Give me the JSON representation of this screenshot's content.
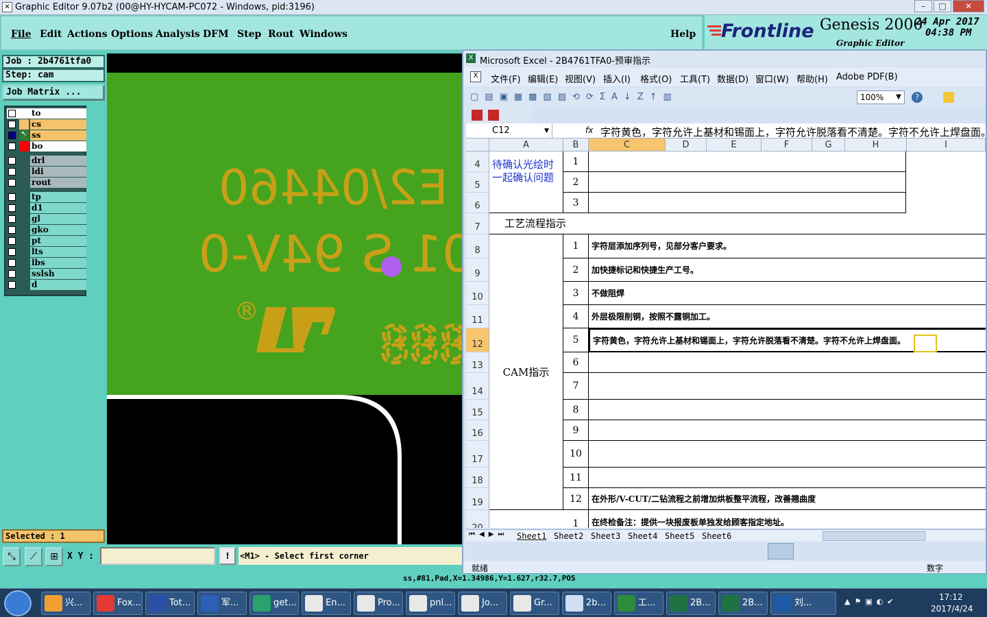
{
  "titlebar": {
    "title": "Graphic Editor 9.07b2 (00@HY-HYCAM-PC072 - Windows, pid:3196)"
  },
  "menu": [
    "File",
    "Edit",
    "Actions",
    "Options",
    "Analysis",
    "DFM",
    "Step",
    "Rout",
    "Windows"
  ],
  "help": "Help",
  "brand": {
    "logo": "Frontline",
    "product": "Genesis 2000",
    "date": "24 Apr 2017",
    "time": "04:38 PM",
    "subtitle": "Graphic Editor"
  },
  "job": {
    "job_label": "Job  : 2b4761tfa0",
    "step_label": "Step: cam",
    "matrix_button": "Job Matrix ..."
  },
  "layers_group1": [
    {
      "name": "to",
      "bg": "#ffffff",
      "color": ""
    },
    {
      "name": "cs",
      "bg": "#f3c26a",
      "color": ""
    },
    {
      "name": "ss",
      "bg": "#f3c26a",
      "color": "#2e7d32"
    },
    {
      "name": "bo",
      "bg": "#ffffff",
      "color": "#ff0000"
    }
  ],
  "layers_group2": [
    {
      "name": "drl"
    },
    {
      "name": "ldi"
    },
    {
      "name": "rout"
    }
  ],
  "layers_group3": [
    {
      "name": "tp"
    },
    {
      "name": "d1"
    },
    {
      "name": "gl"
    },
    {
      "name": "gko"
    },
    {
      "name": "pt"
    },
    {
      "name": "lts"
    },
    {
      "name": "lbs"
    },
    {
      "name": "sslsh"
    },
    {
      "name": "d"
    }
  ],
  "selected": "Selected : 1",
  "canvas_text": {
    "line1": "E2/04460",
    "line2": "01 S 94V-0",
    "digits": "888",
    "mark": "®"
  },
  "bottom": {
    "xy_label": "X Y :",
    "prompt": "<M1> - Select first corner",
    "status": "ss,#81,Pad,X=1.34986,Y=1.627,r32.7,POS"
  },
  "excel": {
    "title": "Microsoft Excel - 2B4761TFA0-预审指示",
    "menu": [
      "文件(F)",
      "编辑(E)",
      "视图(V)",
      "插入(I)",
      "格式(O)",
      "工具(T)",
      "数据(D)",
      "窗口(W)",
      "帮助(H)",
      "Adobe PDF(B)"
    ],
    "zoom": "100%",
    "namebox": "C12",
    "fx": "fx",
    "formula": "字符黄色，字符允许上基材和锡面上，字符允许脱落看不清楚。字符不允许上焊盘面。",
    "columns": [
      "A",
      "B",
      "C",
      "D",
      "E",
      "F",
      "G",
      "H",
      "I"
    ],
    "a_label_1": "待确认光绘时一起确认问题",
    "a_label_2": "工艺流程指示",
    "a_label_3": "CAM指示",
    "rows": [
      {
        "row": "4",
        "b": "1",
        "c": ""
      },
      {
        "row": "5",
        "b": "2",
        "c": ""
      },
      {
        "row": "6",
        "b": "3",
        "c": ""
      },
      {
        "row": "7",
        "b": "",
        "c": ""
      },
      {
        "row": "8",
        "b": "1",
        "c": "字符层添加序列号，见部分客户要求。"
      },
      {
        "row": "9",
        "b": "2",
        "c": "加快捷标记和快捷生产工号。"
      },
      {
        "row": "10",
        "b": "3",
        "c": "不做阻焊"
      },
      {
        "row": "11",
        "b": "4",
        "c": "外层极限削铜，按照不露铜加工。"
      },
      {
        "row": "12",
        "b": "5",
        "c": "字符黄色，字符允许上基材和锡面上，字符允许脱落看不清楚。字符不允许上焊盘面。"
      },
      {
        "row": "13",
        "b": "6",
        "c": ""
      },
      {
        "row": "14",
        "b": "7",
        "c": ""
      },
      {
        "row": "15",
        "b": "8",
        "c": ""
      },
      {
        "row": "16",
        "b": "9",
        "c": ""
      },
      {
        "row": "17",
        "b": "10",
        "c": ""
      },
      {
        "row": "18",
        "b": "11",
        "c": ""
      },
      {
        "row": "19",
        "b": "12",
        "c": "在外形/V-CUT/二钻流程之前增加烘板整平流程，改善翘曲度"
      },
      {
        "row": "20",
        "b": "1",
        "c": "在终检备注：提供一块报废板单独发给顾客指定地址。"
      }
    ],
    "sheets": [
      "Sheet1",
      "Sheet2",
      "Sheet3",
      "Sheet4",
      "Sheet5",
      "Sheet6"
    ],
    "status_ready": "就绪",
    "status_num": "数字"
  },
  "taskbar": {
    "items": [
      "兴...",
      "Fox...",
      "Tot...",
      "军...",
      "get...",
      "En...",
      "Pro...",
      "pnl...",
      "Jo...",
      "Gr...",
      "2b...",
      "工...",
      "2B...",
      "2B...",
      "刘..."
    ],
    "time": "17:12",
    "date": "2017/4/24"
  }
}
